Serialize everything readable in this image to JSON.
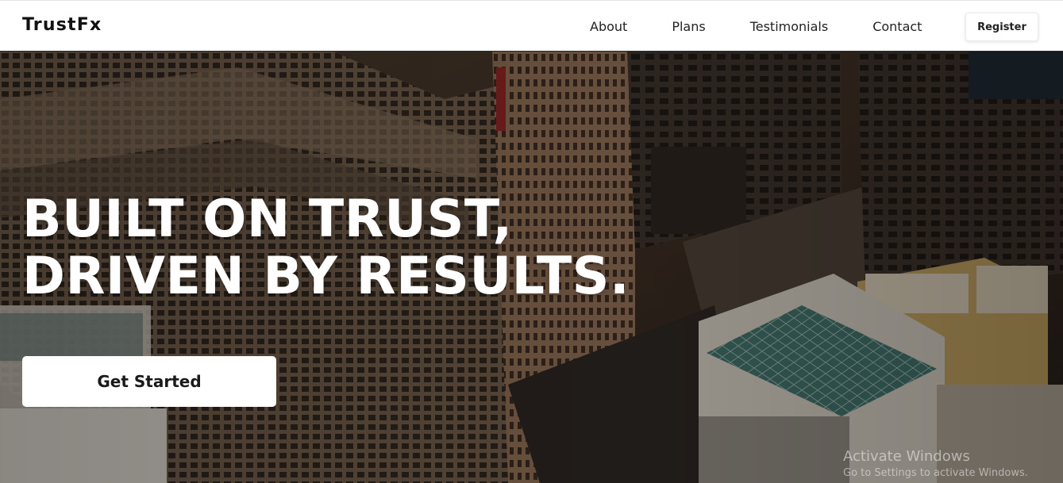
{
  "nav": {
    "brand": "TrustFx",
    "links": [
      "About",
      "Plans",
      "Testimonials",
      "Contact"
    ],
    "register_label": "Register"
  },
  "hero": {
    "title_line_1": "BUILT ON TRUST,",
    "title_line_2": "DRIVEN BY RESULTS.",
    "cta_label": "Get Started",
    "background": "aerial-city-buildings-image"
  },
  "watermark": {
    "title": "Activate Windows",
    "subtitle": "Go to Settings to activate Windows."
  },
  "colors": {
    "nav_bg": "#ffffff",
    "hero_text": "#ffffff",
    "button_bg": "#ffffff",
    "button_text": "#1a1a1a"
  }
}
